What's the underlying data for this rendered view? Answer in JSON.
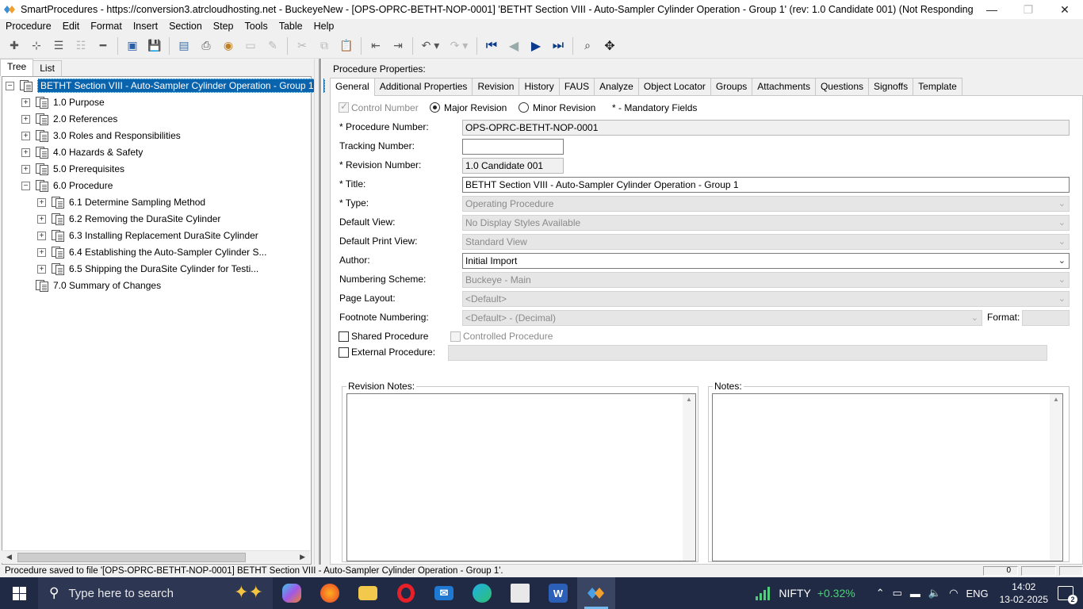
{
  "window": {
    "title": "SmartProcedures - https://conversion3.atrcloudhosting.net - BuckeyeNew - [OPS-OPRC-BETHT-NOP-0001] 'BETHT Section VIII - Auto-Sampler Cylinder Operation - Group 1' (rev: 1.0 Candidate 001) (Not Responding)",
    "minimize": "—",
    "maximize": "❐",
    "close": "✕"
  },
  "menu": [
    "Procedure",
    "Edit",
    "Format",
    "Insert",
    "Section",
    "Step",
    "Tools",
    "Table",
    "Help"
  ],
  "left": {
    "tabs": [
      "Tree",
      "List"
    ],
    "tree": [
      {
        "label": "BETHT Section VIII - Auto-Sampler Cylinder Operation - Group 1...",
        "exp": "−",
        "level": 0,
        "selected": true
      },
      {
        "label": "1.0 Purpose",
        "exp": "+",
        "level": 1
      },
      {
        "label": "2.0 References",
        "exp": "+",
        "level": 1
      },
      {
        "label": "3.0 Roles and Responsibilities",
        "exp": "+",
        "level": 1
      },
      {
        "label": "4.0 Hazards & Safety",
        "exp": "+",
        "level": 1
      },
      {
        "label": "5.0 Prerequisites",
        "exp": "+",
        "level": 1
      },
      {
        "label": "6.0 Procedure",
        "exp": "−",
        "level": 1
      },
      {
        "label": "6.1 Determine Sampling Method",
        "exp": "+",
        "level": 2
      },
      {
        "label": "6.2 Removing the DuraSite Cylinder",
        "exp": "+",
        "level": 2
      },
      {
        "label": "6.3 Installing Replacement DuraSite Cylinder",
        "exp": "+",
        "level": 2
      },
      {
        "label": "6.4 Establishing the Auto-Sampler Cylinder S...",
        "exp": "+",
        "level": 2
      },
      {
        "label": "6.5 Shipping the DuraSite Cylinder for Testi...",
        "exp": "+",
        "level": 2
      },
      {
        "label": "7.0 Summary of Changes",
        "exp": "",
        "level": 1
      }
    ]
  },
  "right": {
    "props_title": "Procedure Properties:",
    "tabs": [
      "General",
      "Additional Properties",
      "Revision",
      "History",
      "FAUS",
      "Analyze",
      "Object Locator",
      "Groups",
      "Attachments",
      "Questions",
      "Signoffs",
      "Template"
    ],
    "control_number": "Control Number",
    "major_revision": "Major Revision",
    "minor_revision": "Minor Revision",
    "mandatory_note": "* - Mandatory Fields",
    "labels": {
      "procedure_number": "* Procedure Number:",
      "tracking_number": "Tracking Number:",
      "revision_number": "* Revision Number:",
      "title": "* Title:",
      "type": "* Type:",
      "default_view": "Default View:",
      "default_print_view": "Default Print View:",
      "author": "Author:",
      "numbering_scheme": "Numbering Scheme:",
      "page_layout": "Page Layout:",
      "footnote_numbering": "Footnote Numbering:",
      "format": "Format:",
      "shared_procedure": "Shared Procedure",
      "controlled_procedure": "Controlled Procedure",
      "external_procedure": "External Procedure:",
      "revision_notes": "Revision Notes:",
      "notes": "Notes:"
    },
    "values": {
      "procedure_number": "OPS-OPRC-BETHT-NOP-0001",
      "tracking_number": "",
      "revision_number": "1.0 Candidate 001",
      "title": "BETHT Section VIII - Auto-Sampler Cylinder Operation - Group 1",
      "type": "Operating Procedure",
      "default_view": "No Display Styles Available",
      "default_print_view": "Standard View",
      "author": "Initial Import",
      "numbering_scheme": "Buckeye - Main",
      "page_layout": "<Default>",
      "footnote_numbering": "<Default> - (Decimal)",
      "format": "",
      "external_procedure": ""
    }
  },
  "status": {
    "text": "Procedure saved to file '[OPS-OPRC-BETHT-NOP-0001] BETHT Section VIII - Auto-Sampler Cylinder Operation - Group 1'.",
    "cell_value": "0"
  },
  "taskbar": {
    "search_placeholder": "Type here to search",
    "stock_name": "NIFTY",
    "stock_change": "+0.32%",
    "lang": "ENG",
    "time": "14:02",
    "date": "13-02-2025",
    "notif_count": "2"
  }
}
